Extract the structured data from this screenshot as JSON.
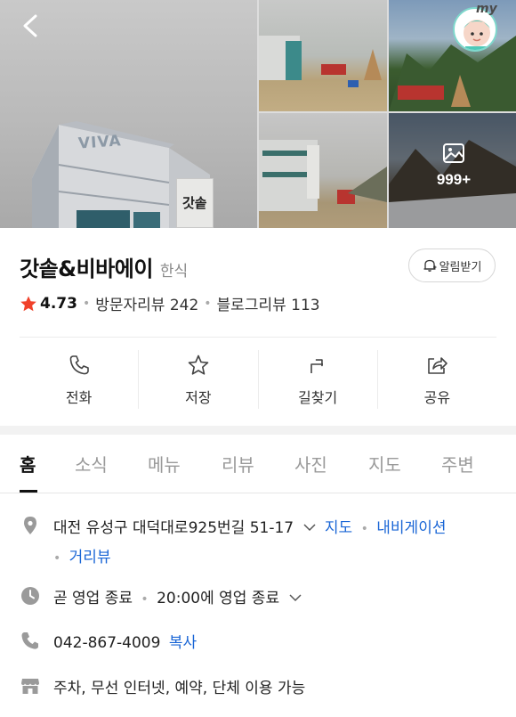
{
  "gallery": {
    "main_building_label": "VIVA",
    "main_sign_text": "갓솥",
    "profile_badge_text": "my",
    "more_photos_count": "999+",
    "back_icon": "chevron-left-icon",
    "more_photos_icon": "image-icon"
  },
  "place": {
    "name": "갓솥&비바에이",
    "category": "한식",
    "alarm_label": "알림받기",
    "rating": "4.73",
    "visitor_reviews": "방문자리뷰 242",
    "blog_reviews": "블로그리뷰 113",
    "star_color": "#f0412a"
  },
  "actions": [
    {
      "label": "전화",
      "icon": "phone-icon"
    },
    {
      "label": "저장",
      "icon": "star-icon"
    },
    {
      "label": "길찾기",
      "icon": "directions-icon"
    },
    {
      "label": "공유",
      "icon": "share-icon"
    }
  ],
  "tabs": [
    "홈",
    "소식",
    "메뉴",
    "리뷰",
    "사진",
    "지도",
    "주변"
  ],
  "details": {
    "address": "대전 유성구 대덕대로925번길 51-17",
    "map_link": "지도",
    "navigation_link": "내비게이션",
    "street_view_link": "거리뷰",
    "hours_status": "곧 영업 종료",
    "hours_detail": "20:00에 영업 종료",
    "phone": "042-867-4009",
    "copy_label": "복사",
    "amenities": "주차, 무선 인터넷, 예약, 단체 이용 가능",
    "link_color": "#1a66d6"
  }
}
